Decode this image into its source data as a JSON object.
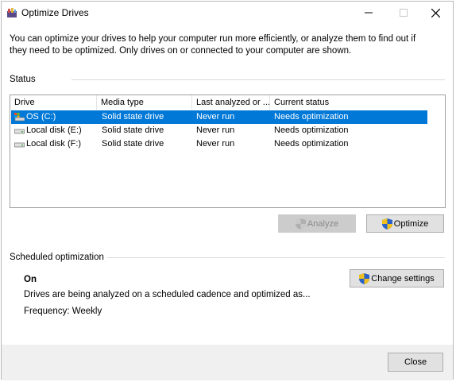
{
  "window": {
    "title": "Optimize Drives"
  },
  "intro": "You can optimize your drives to help your computer run more efficiently, or analyze them to find out if they need to be optimized. Only drives on or connected to your computer are shown.",
  "status": {
    "label": "Status",
    "columns": [
      "Drive",
      "Media type",
      "Last analyzed or ...",
      "Current status"
    ],
    "rows": [
      {
        "drive": "OS (C:)",
        "media": "Solid state drive",
        "last": "Never run",
        "status": "Needs optimization",
        "selected": true
      },
      {
        "drive": "Local disk (E:)",
        "media": "Solid state drive",
        "last": "Never run",
        "status": "Needs optimization",
        "selected": false
      },
      {
        "drive": "Local disk (F:)",
        "media": "Solid state drive",
        "last": "Never run",
        "status": "Needs optimization",
        "selected": false
      }
    ]
  },
  "buttons": {
    "analyze": "Analyze",
    "optimize": "Optimize",
    "change_settings": "Change settings",
    "close": "Close"
  },
  "scheduled": {
    "label": "Scheduled optimization",
    "state": "On",
    "description": "Drives are being analyzed on a scheduled cadence and optimized as...",
    "frequency": "Frequency: Weekly"
  },
  "colors": {
    "selection": "#0078d7",
    "button_face": "#e1e1e1",
    "footer": "#f0f0f0"
  }
}
